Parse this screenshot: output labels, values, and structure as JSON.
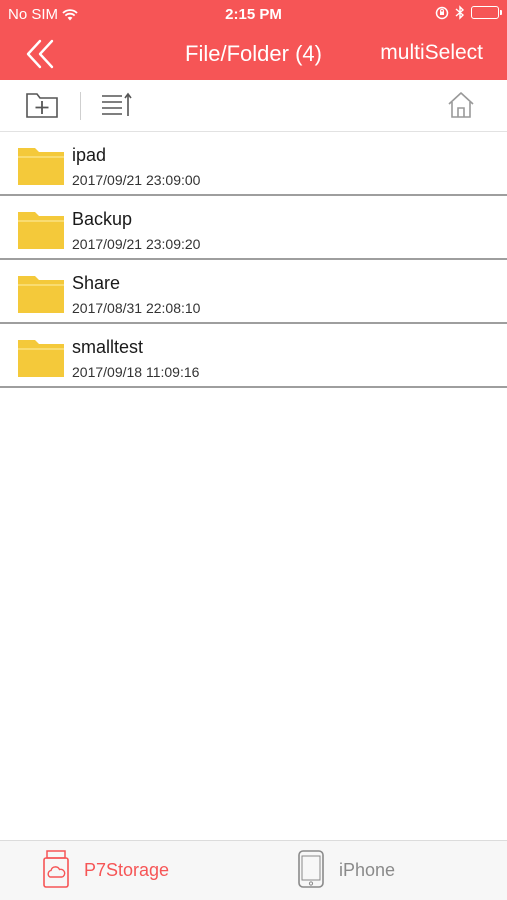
{
  "colors": {
    "accent": "#f65556",
    "folder": "#f4c93a",
    "tab_active": "#f65556",
    "tab_inactive": "#8a8a8a"
  },
  "status_bar": {
    "carrier": "No SIM",
    "time": "2:15 PM"
  },
  "nav": {
    "title": "File/Folder (4)",
    "multi_select": "multiSelect",
    "back_icon": "double-chevron-left-icon"
  },
  "toolbar": {
    "new_folder_icon": "folder-plus-icon",
    "sort_icon": "sort-list-icon",
    "home_icon": "home-icon"
  },
  "files": [
    {
      "name": "ipad",
      "date": "2017/09/21 23:09:00"
    },
    {
      "name": "Backup",
      "date": "2017/09/21 23:09:20"
    },
    {
      "name": "Share",
      "date": "2017/08/31 22:08:10"
    },
    {
      "name": "smalltest",
      "date": "2017/09/18 11:09:16"
    }
  ],
  "tabs": [
    {
      "label": "P7Storage",
      "icon": "storage-cloud-icon",
      "active": true
    },
    {
      "label": "iPhone",
      "icon": "iphone-icon",
      "active": false
    }
  ]
}
